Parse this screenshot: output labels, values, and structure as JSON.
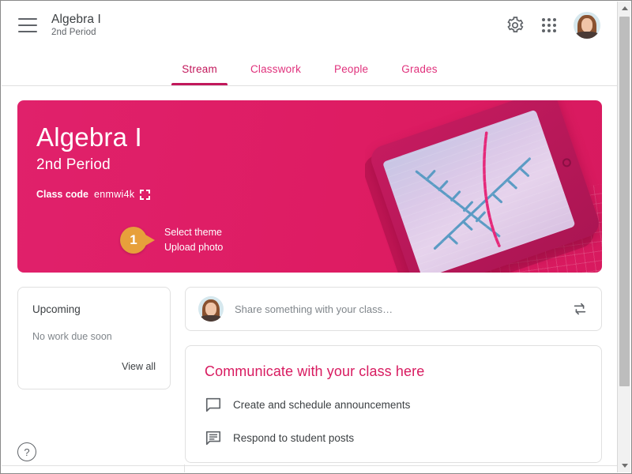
{
  "header": {
    "menu_icon": "hamburger-menu-icon",
    "title": "Algebra I",
    "subtitle": "2nd Period",
    "settings_icon": "gear-icon",
    "apps_icon": "apps-grid-icon",
    "avatar_icon": "user-avatar"
  },
  "tabs": [
    {
      "label": "Stream",
      "active": true
    },
    {
      "label": "Classwork",
      "active": false
    },
    {
      "label": "People",
      "active": false
    },
    {
      "label": "Grades",
      "active": false
    }
  ],
  "hero": {
    "title": "Algebra I",
    "subtitle": "2nd Period",
    "class_code_label": "Class code",
    "class_code_value": "enmwi4k",
    "expand_icon": "fullscreen-expand-icon",
    "banner_color": "#e0216b",
    "callout": {
      "number": "1",
      "badge_color": "#e7a03b",
      "lines": [
        "Select theme",
        "Upload photo"
      ]
    },
    "illustration": "tablet-with-graph"
  },
  "upcoming": {
    "title": "Upcoming",
    "empty_text": "No work due soon",
    "view_all": "View all"
  },
  "share_box": {
    "placeholder": "Share something with your class…",
    "avatar_icon": "user-avatar",
    "reuse_icon": "reuse-post-icon"
  },
  "communicate": {
    "title": "Communicate with your class here",
    "accent_color": "#d81b60",
    "items": [
      {
        "icon": "speech-bubble-icon",
        "label": "Create and schedule announcements"
      },
      {
        "icon": "comment-lines-icon",
        "label": "Respond to student posts"
      }
    ]
  },
  "help": {
    "icon": "help-question-icon",
    "label": "?"
  },
  "scrollbar": {
    "up_icon": "scroll-up-arrow",
    "down_icon": "scroll-down-arrow"
  }
}
